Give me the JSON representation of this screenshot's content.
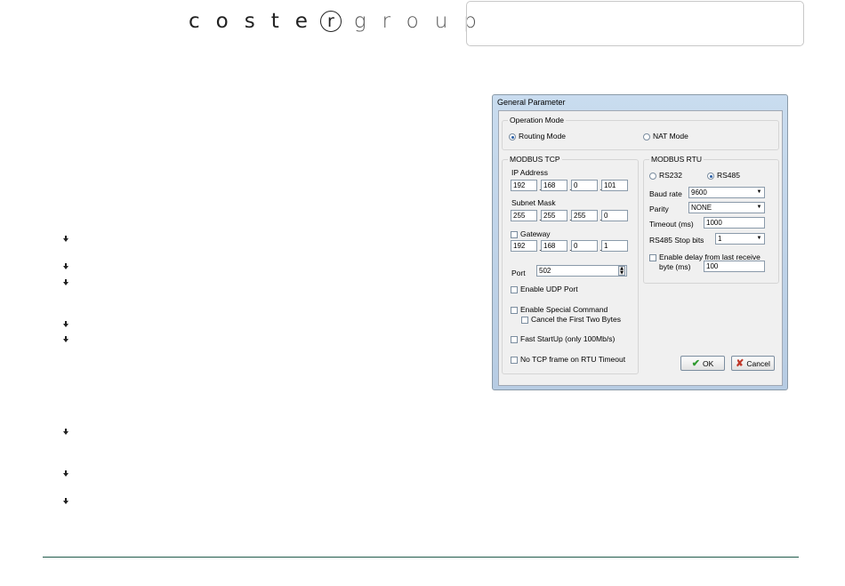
{
  "header": {
    "logo_left": "coste",
    "logo_mark": "r",
    "logo_right": "group"
  },
  "bullets": {
    "icon": "arrow-bullet-icon",
    "count": 8
  },
  "dialog": {
    "title": "General Parameter",
    "operation_mode": {
      "label": "Operation Mode",
      "options": [
        "Routing Mode",
        "NAT Mode"
      ],
      "selected": "Routing Mode"
    },
    "modbus_tcp": {
      "label": "MODBUS TCP",
      "ip_address_label": "IP Address",
      "ip_address": [
        "192",
        "168",
        "0",
        "101"
      ],
      "subnet_mask_label": "Subnet Mask",
      "subnet_mask": [
        "255",
        "255",
        "255",
        "0"
      ],
      "gateway_label": "Gateway",
      "gateway": [
        "192",
        "168",
        "0",
        "1"
      ],
      "port_label": "Port",
      "port_value": "502",
      "enable_udp_port": "Enable UDP Port",
      "enable_special_command": "Enable Special Command",
      "cancel_first_two_bytes": "Cancel the First Two Bytes",
      "fast_startup": "Fast StartUp (only 100Mb/s)",
      "no_tcp_frame": "No TCP frame on RTU Timeout"
    },
    "modbus_rtu": {
      "label": "MODBUS RTU",
      "options": [
        "RS232",
        "RS485"
      ],
      "selected": "RS485",
      "baud_rate_label": "Baud rate",
      "baud_rate_value": "9600",
      "parity_label": "Parity",
      "parity_value": "NONE",
      "timeout_label": "Timeout (ms)",
      "timeout_value": "1000",
      "stop_bits_label": "RS485 Stop bits",
      "stop_bits_value": "1",
      "enable_delay_line1": "Enable delay from last receive",
      "enable_delay_line2": "byte (ms)",
      "delay_value": "100"
    },
    "buttons": {
      "ok": "OK",
      "cancel": "Cancel"
    }
  },
  "colors": {
    "footer_line": "#1f5a4a",
    "dialog_frame": "#c9dcef"
  }
}
